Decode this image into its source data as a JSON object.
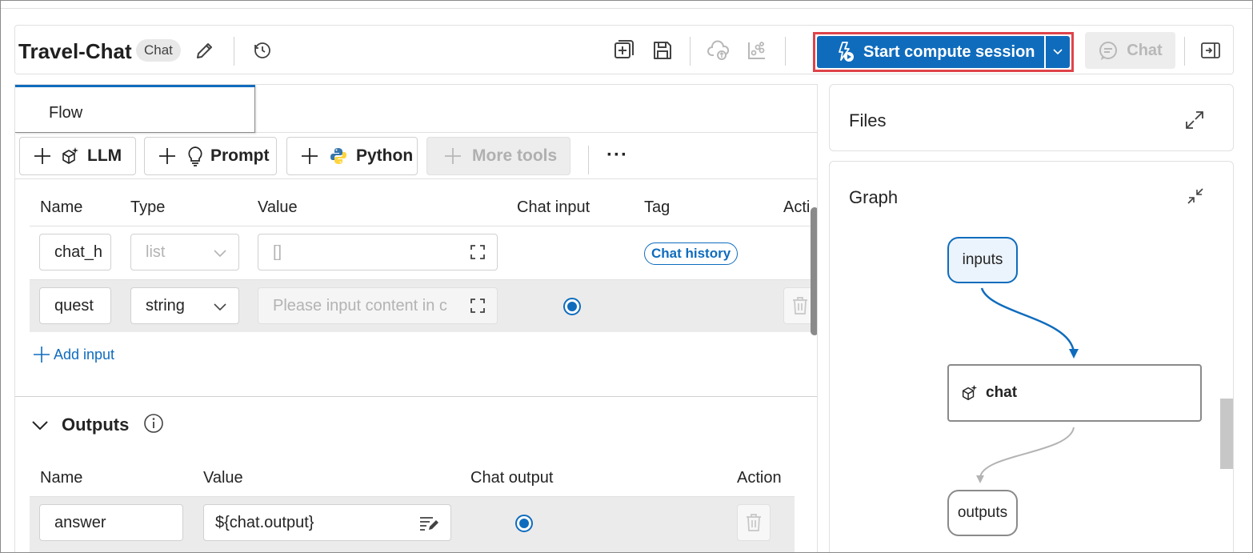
{
  "header": {
    "title": "Travel-Chat",
    "badge": "Chat",
    "start_session_label": "Start compute session",
    "chat_label": "Chat"
  },
  "tabs": [
    {
      "label": "Flow"
    }
  ],
  "toolbar": {
    "llm_label": "LLM",
    "prompt_label": "Prompt",
    "python_label": "Python",
    "more_tools_label": "More tools",
    "overflow": "···"
  },
  "inputs": {
    "columns": [
      "Name",
      "Type",
      "Value",
      "Chat input",
      "Tag",
      "Acti"
    ],
    "rows": [
      {
        "name": "chat_h",
        "type": "list",
        "value": "[]",
        "tag": "Chat history"
      },
      {
        "name": "quest",
        "type": "string",
        "value_placeholder": "Please input content in c"
      }
    ],
    "add_label": "Add input"
  },
  "outputs": {
    "title": "Outputs",
    "columns": [
      "Name",
      "Value",
      "Chat output",
      "Action"
    ],
    "rows": [
      {
        "name": "answer",
        "value": "${chat.output}"
      }
    ]
  },
  "files": {
    "title": "Files"
  },
  "graph": {
    "title": "Graph",
    "nodes": {
      "inputs": "inputs",
      "chat": "chat",
      "outputs": "outputs"
    }
  },
  "colors": {
    "accent": "#0f6cbd",
    "highlight_border": "#e0434a"
  }
}
